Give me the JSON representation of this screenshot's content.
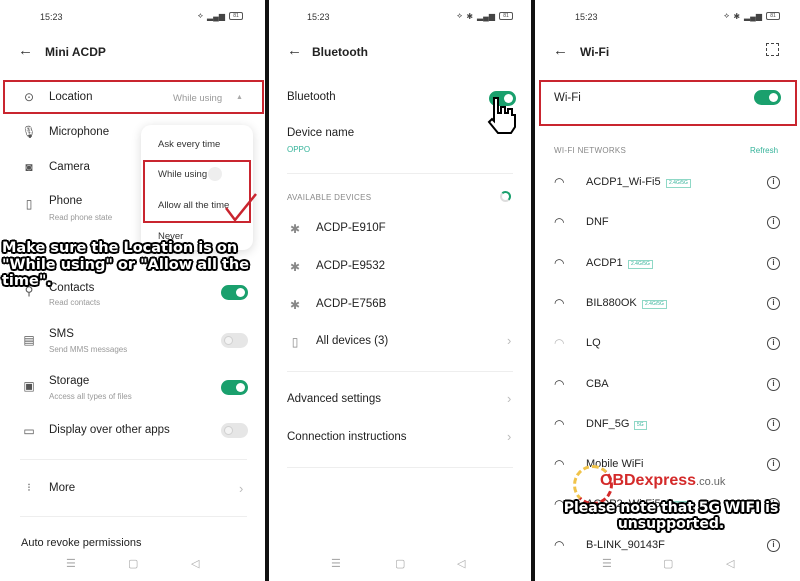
{
  "panel_location": {
    "status": {
      "time": "15:23",
      "battery": "81"
    },
    "header": {
      "back": "←",
      "title": "Mini ACDP"
    },
    "rows": [
      {
        "label": "Location",
        "value": "While using",
        "icon": "location-pin-icon"
      },
      {
        "label": "Microphone",
        "icon": "microphone-icon"
      },
      {
        "label": "Camera",
        "icon": "camera-icon"
      },
      {
        "label": "Phone",
        "sub": "Read phone state",
        "icon": "phone-icon"
      },
      {
        "label": "Contacts",
        "sub": "Read contacts",
        "icon": "contacts-icon",
        "toggle": true
      },
      {
        "label": "SMS",
        "sub": "Send MMS messages",
        "icon": "sms-icon",
        "toggle": false
      },
      {
        "label": "Storage",
        "sub": "Access all types of files",
        "icon": "storage-icon",
        "toggle": true
      },
      {
        "label": "Display over other apps",
        "icon": "display-over-icon",
        "toggle": false
      },
      {
        "label": "More",
        "icon": "more-icon"
      },
      {
        "label": "Auto revoke permissions"
      }
    ],
    "popup": {
      "options": [
        "Ask every time",
        "While using",
        "Allow all the time",
        "Never"
      ],
      "selected": "While using"
    },
    "caption": "Make sure the Location is on \"While using\" or  \"Allow all the time\"."
  },
  "panel_bluetooth": {
    "status": {
      "time": "15:23",
      "battery": "81"
    },
    "header": {
      "back": "←",
      "title": "Bluetooth"
    },
    "bluetooth_label": "Bluetooth",
    "bluetooth_on": true,
    "device_name_label": "Device name",
    "device_name_value": "OPPO",
    "available_header": "AVAILABLE DEVICES",
    "devices": [
      "ACDP-E910F",
      "ACDP-E9532",
      "ACDP-E756B"
    ],
    "all_devices": "All devices (3)",
    "advanced": "Advanced settings",
    "connection": "Connection instructions"
  },
  "panel_wifi": {
    "status": {
      "time": "15:23",
      "battery": "81"
    },
    "header": {
      "back": "←",
      "title": "Wi-Fi"
    },
    "wifi_label": "Wi-Fi",
    "wifi_on": true,
    "networks_header": "WI-FI NETWORKS",
    "refresh": "Refresh",
    "networks": [
      {
        "name": "ACDP1_Wi-Fi5",
        "tag": "2.4G/5G"
      },
      {
        "name": "DNF",
        "tag": ""
      },
      {
        "name": "ACDP1",
        "tag": "2.4G/5G"
      },
      {
        "name": "BIL880OK",
        "tag": "2.4G/5G"
      },
      {
        "name": "LQ",
        "tag": ""
      },
      {
        "name": "CBA",
        "tag": ""
      },
      {
        "name": "DNF_5G",
        "tag": "5G"
      },
      {
        "name": "Mobile WiFi",
        "tag": ""
      },
      {
        "name": "ACDP2_Wi-Fi5",
        "tag": "2.4G/5G"
      },
      {
        "name": "B-LINK_90143F",
        "tag": ""
      }
    ],
    "watermark": {
      "brand": "OBDexpress",
      "domain": ".co.uk"
    },
    "caption": "Please note that 5G WIFI is unsupported."
  },
  "navbar": {
    "menu": "☰",
    "home": "▢",
    "back": "◁"
  },
  "colors": {
    "accent": "#1aa06d",
    "highlight": "#c9252f",
    "link": "#35b39a"
  }
}
